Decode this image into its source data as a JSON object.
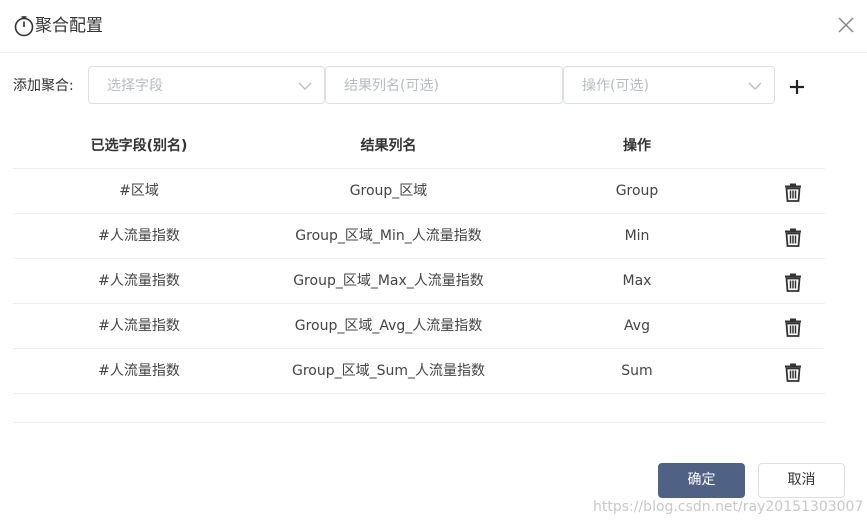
{
  "dialog": {
    "title": "聚合配置",
    "close_icon": "close-icon",
    "title_icon": "stopwatch-icon"
  },
  "add_row": {
    "label": "添加聚合:",
    "field_select": {
      "placeholder": "选择字段"
    },
    "result_name": {
      "placeholder": "结果列名(可选)"
    },
    "operation_select": {
      "placeholder": "操作(可选)"
    },
    "add_icon": "plus-icon"
  },
  "table": {
    "headers": [
      "已选字段(别名)",
      "结果列名",
      "操作"
    ],
    "rows": [
      {
        "field": "#区域",
        "result": "Group_区域",
        "op": "Group"
      },
      {
        "field": "#人流量指数",
        "result": "Group_区域_Min_人流量指数",
        "op": "Min"
      },
      {
        "field": "#人流量指数",
        "result": "Group_区域_Max_人流量指数",
        "op": "Max"
      },
      {
        "field": "#人流量指数",
        "result": "Group_区域_Avg_人流量指数",
        "op": "Avg"
      },
      {
        "field": "#人流量指数",
        "result": "Group_区域_Sum_人流量指数",
        "op": "Sum"
      }
    ],
    "row_action_icon": "trash-icon"
  },
  "footer": {
    "confirm_label": "确定",
    "cancel_label": "取消"
  },
  "watermark": "https://blog.csdn.net/ray20151303007",
  "colors": {
    "primary": "#4f6184",
    "border": "#dcdfe6",
    "placeholder": "#b8bcc4"
  }
}
